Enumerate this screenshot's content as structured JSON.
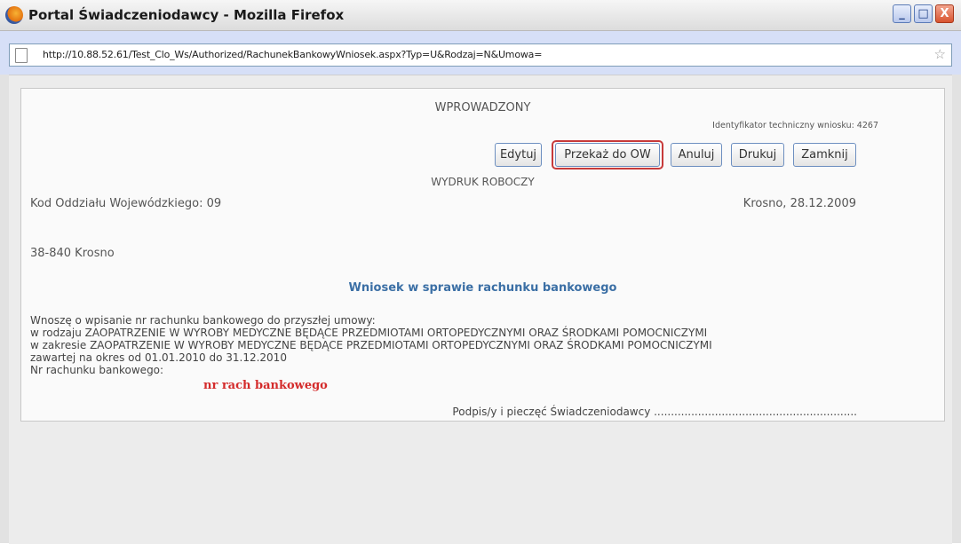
{
  "window": {
    "title": "Portal Świadczeniodawcy - Mozilla Firefox",
    "minimize_label": "_",
    "maximize_label": "□",
    "close_label": "X"
  },
  "address_bar": {
    "url": "http://10.88.52.61/Test_Clo_Ws/Authorized/RachunekBankowyWniosek.aspx?Typ=U&Rodzaj=N&Umowa="
  },
  "document": {
    "status": "WPROWADZONY",
    "technical_id": "Identyfikator techniczny wniosku: 4267",
    "buttons": [
      "Edytuj",
      "Przekaż do OW",
      "Anuluj",
      "Drukuj",
      "Zamknij"
    ],
    "draft_label": "WYDRUK ROBOCZY",
    "branch_code": "Kod Oddziału Wojewódzkiego: 09",
    "place_date": "Krosno, 28.12.2009",
    "address_line": "38-840 Krosno",
    "heading": "Wniosek w sprawie rachunku bankowego",
    "body": [
      "Wnoszę o wpisanie nr rachunku bankowego do przyszłej umowy:",
      "w rodzaju ZAOPATRZENIE W WYROBY MEDYCZNE BĘDĄCE PRZEDMIOTAMI ORTOPEDYCZNYMI ORAZ ŚRODKAMI POMOCNICZYMI",
      "w zakresie ZAOPATRZENIE W WYROBY MEDYCZNE BĘDĄCE PRZEDMIOTAMI ORTOPEDYCZNYMI ORAZ ŚRODKAMI POMOCNICZYMI",
      "zawartej na okres od 01.01.2010 do 31.12.2010"
    ],
    "account_label": "Nr rachunku bankowego:",
    "account_value": "nr rach bankowego",
    "signature": "Podpis/y i pieczęć Świadczeniodawcy ............................................................"
  },
  "colors": {
    "highlight_border": "#c73a3a",
    "heading": "#3b6fa5",
    "account_value": "#d42b2b"
  }
}
